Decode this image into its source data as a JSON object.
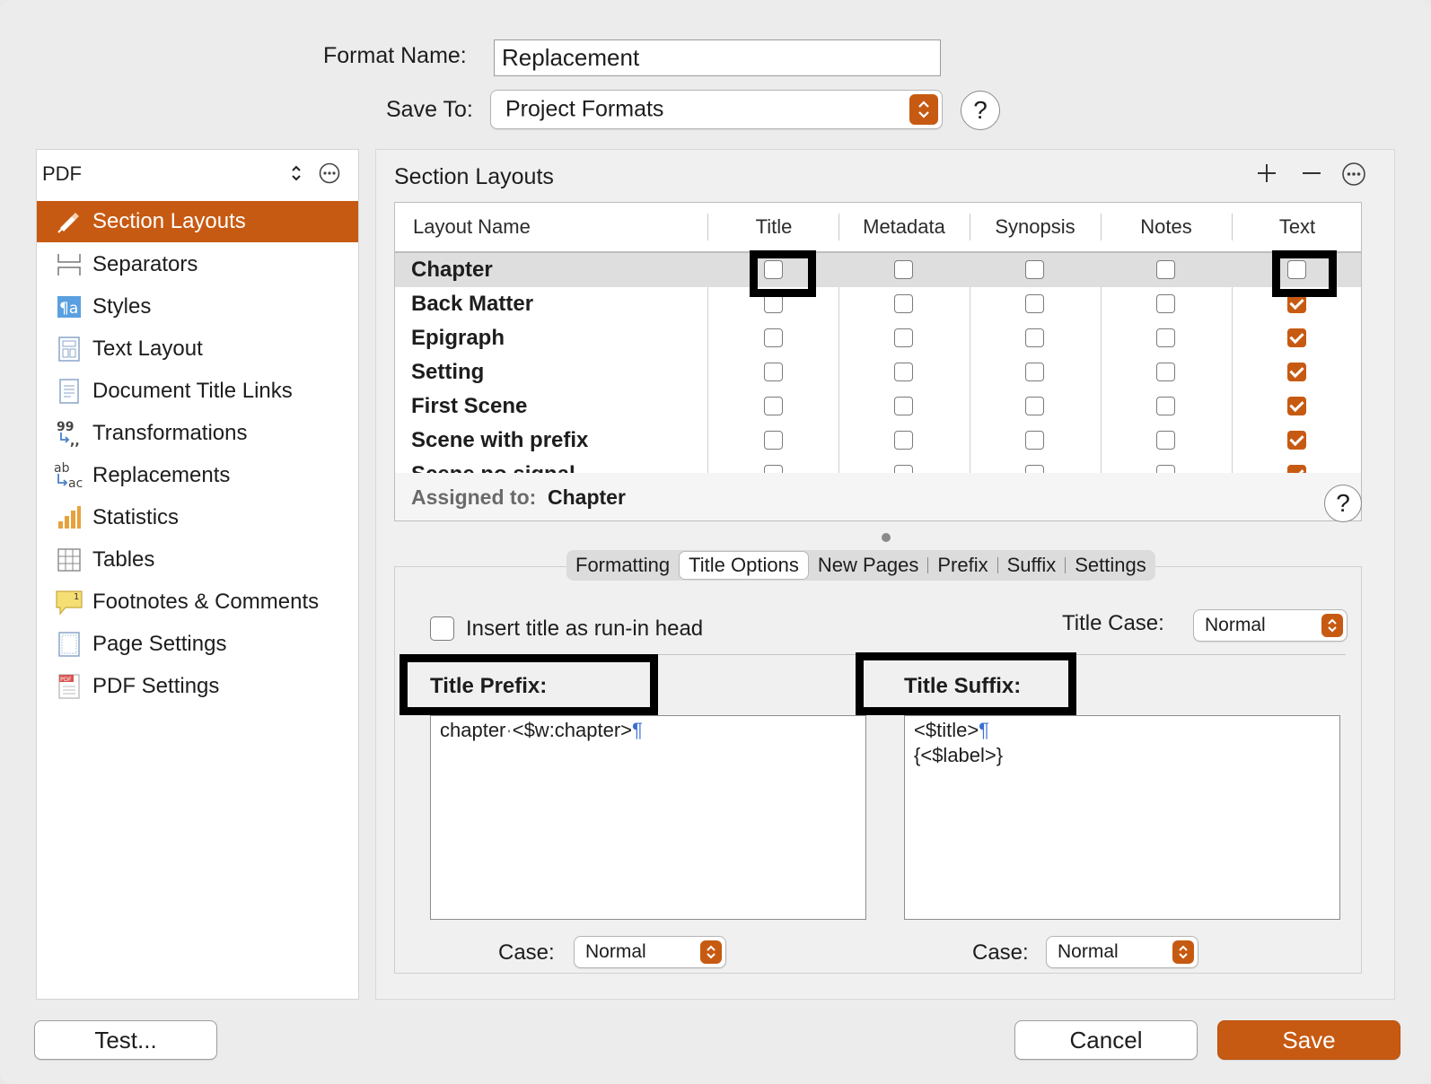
{
  "header": {
    "format_name_label": "Format Name:",
    "format_name_value": "Replacement",
    "save_to_label": "Save To:",
    "save_to_value": "Project Formats",
    "help": "?"
  },
  "sidebar": {
    "format_type": "PDF",
    "items": [
      {
        "label": "Section Layouts",
        "icon": "section-layouts-icon",
        "selected": true
      },
      {
        "label": "Separators",
        "icon": "separators-icon"
      },
      {
        "label": "Styles",
        "icon": "styles-icon"
      },
      {
        "label": "Text Layout",
        "icon": "text-layout-icon"
      },
      {
        "label": "Document Title Links",
        "icon": "document-title-links-icon"
      },
      {
        "label": "Transformations",
        "icon": "transformations-icon"
      },
      {
        "label": "Replacements",
        "icon": "replacements-icon"
      },
      {
        "label": "Statistics",
        "icon": "statistics-icon"
      },
      {
        "label": "Tables",
        "icon": "tables-icon"
      },
      {
        "label": "Footnotes & Comments",
        "icon": "footnotes-icon"
      },
      {
        "label": "Page Settings",
        "icon": "page-settings-icon"
      },
      {
        "label": "PDF Settings",
        "icon": "pdf-settings-icon"
      }
    ]
  },
  "main": {
    "title": "Section Layouts",
    "columns": [
      "Layout Name",
      "Title",
      "Metadata",
      "Synopsis",
      "Notes",
      "Text"
    ],
    "rows": [
      {
        "name": "Chapter",
        "title": false,
        "metadata": false,
        "synopsis": false,
        "notes": false,
        "text": false
      },
      {
        "name": "Back Matter",
        "title": false,
        "metadata": false,
        "synopsis": false,
        "notes": false,
        "text": true
      },
      {
        "name": "Epigraph",
        "title": false,
        "metadata": false,
        "synopsis": false,
        "notes": false,
        "text": true
      },
      {
        "name": "Setting",
        "title": false,
        "metadata": false,
        "synopsis": false,
        "notes": false,
        "text": true
      },
      {
        "name": "First Scene",
        "title": false,
        "metadata": false,
        "synopsis": false,
        "notes": false,
        "text": true
      },
      {
        "name": "Scene with prefix",
        "title": false,
        "metadata": false,
        "synopsis": false,
        "notes": false,
        "text": true
      },
      {
        "name": "Scene no signal",
        "title": false,
        "metadata": false,
        "synopsis": false,
        "notes": false,
        "text": true
      }
    ],
    "assigned_label": "Assigned to:",
    "assigned_value": "Chapter",
    "tabs": [
      "Formatting",
      "Title Options",
      "New Pages",
      "Prefix",
      "Suffix",
      "Settings"
    ],
    "selected_tab": "Title Options",
    "run_in_label": "Insert title as run-in head",
    "title_case_label": "Title Case:",
    "title_case_value": "Normal",
    "title_prefix_label": "Title Prefix:",
    "title_prefix_text_a": "chapter",
    "title_prefix_text_b": "<$w:chapter>",
    "title_suffix_label": "Title Suffix:",
    "title_suffix_line1": "<$title>",
    "title_suffix_line2": "{<$label>}",
    "pilcrow": "¶",
    "case_label": "Case:",
    "prefix_case_value": "Normal",
    "suffix_case_value": "Normal"
  },
  "footer": {
    "test_label": "Test...",
    "cancel_label": "Cancel",
    "save_label": "Save"
  },
  "colors": {
    "accent": "#c75a12",
    "pilcrow": "#3b6fd4"
  }
}
